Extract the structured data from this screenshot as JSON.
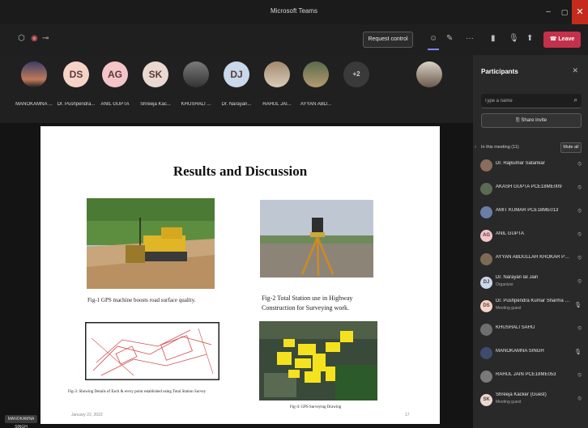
{
  "window": {
    "title": "Microsoft Teams"
  },
  "toolbar": {
    "request_control_label": "Request control",
    "leave_label": "Leave"
  },
  "strip": {
    "participants": [
      {
        "initials": "",
        "name": "MANOKAMNA ..."
      },
      {
        "initials": "DS",
        "name": "Dr. Pushpendra..."
      },
      {
        "initials": "AG",
        "name": "ANIL GUPTA"
      },
      {
        "initials": "SK",
        "name": "Shreeja Kac..."
      },
      {
        "initials": "",
        "name": "KHUSHALI ..."
      },
      {
        "initials": "DJ",
        "name": "Dr. Narayan..."
      },
      {
        "initials": "",
        "name": "RAHUL JAI..."
      },
      {
        "initials": "",
        "name": "AYYAN ABD..."
      },
      {
        "initials": "+2",
        "name": ""
      }
    ]
  },
  "slide": {
    "title": "Results and Discussion",
    "fig1_caption": "Fig-1 GPS machine boosts road surface quality.",
    "fig2_caption_line1": "Fig-2 Total Station use in Highway",
    "fig2_caption_line2": "Construction for Surveying work.",
    "fig3_caption": "Fig-3: Showing Details of Each & every point established using Total Station Survey",
    "fig4_caption": "Fig-4: GPS Surveying Drawing",
    "footer_date": "January 22, 2022",
    "footer_page": "17",
    "presenter_name": "MANOKAMNA SINGH"
  },
  "panel": {
    "title": "Participants",
    "search_placeholder": "Type a name",
    "share_invite_label": "Share invite",
    "in_meeting_label": "In this meeting (11)",
    "mute_all_label": "Mute all",
    "participants": [
      {
        "initials": "",
        "name": "Dr. Rajkumar Satankar",
        "role": "",
        "color": "#8a6d5c"
      },
      {
        "initials": "",
        "name": "AKASH GUPTA PCE18ME009",
        "role": "",
        "color": "#5b6b54"
      },
      {
        "initials": "",
        "name": "AMIT KUMAR PCE18ME013",
        "role": "",
        "color": "#6a7fa8"
      },
      {
        "initials": "AG",
        "name": "ANIL GUPTA",
        "role": "",
        "color": "#f3c4c8"
      },
      {
        "initials": "",
        "name": "AYYAN ABDULLAH KHOKAR PC...",
        "role": "",
        "color": "#7d6a55"
      },
      {
        "initials": "DJ",
        "name": "Dr. Narayan lal Jain",
        "role": "Organizer",
        "color": "#c9d8ea"
      },
      {
        "initials": "DS",
        "name": "Dr. Pushpendra Kumar Sharma (...",
        "role": "Meeting guest",
        "color": "#f6d3c7"
      },
      {
        "initials": "",
        "name": "KHUSHALI SAHU",
        "role": "",
        "color": "#6f6f6f"
      },
      {
        "initials": "",
        "name": "MANOKAMNA SINGH",
        "role": "",
        "color": "#3d4b6e"
      },
      {
        "initials": "",
        "name": "RAHUL JAIN PCE18ME053",
        "role": "",
        "color": "#7a7a7a"
      },
      {
        "initials": "SK",
        "name": "Shreeja Kacker (Guest)",
        "role": "Meeting guest",
        "color": "#ead9d0"
      }
    ]
  },
  "colors": {
    "leave_button": "#c4314b",
    "close_button": "#c42b1c",
    "accent": "#7f85f5"
  }
}
